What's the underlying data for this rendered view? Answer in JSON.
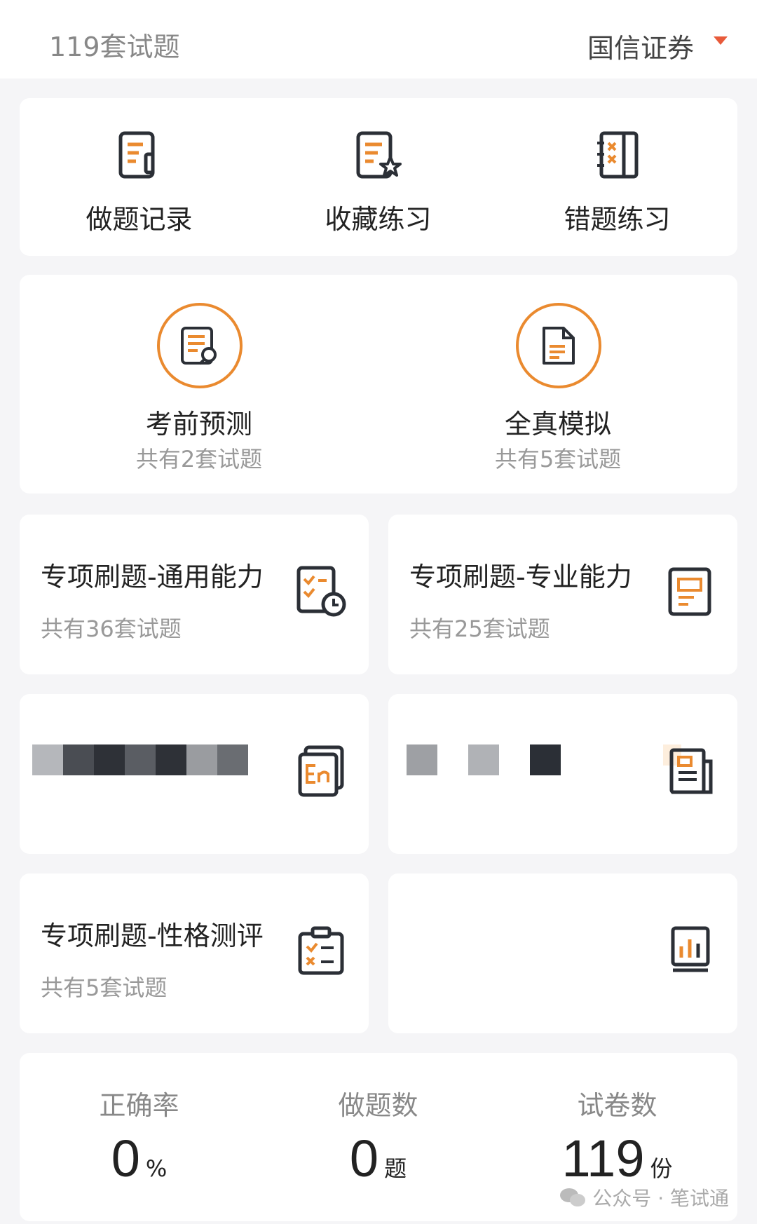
{
  "header": {
    "count_label": "119套试题",
    "org_label": "国信证券"
  },
  "quick_actions": [
    {
      "label": "做题记录",
      "icon": "record-icon"
    },
    {
      "label": "收藏练习",
      "icon": "favorite-icon"
    },
    {
      "label": "错题练习",
      "icon": "wrong-icon"
    }
  ],
  "featured": [
    {
      "title": "考前预测",
      "subtitle": "共有2套试题",
      "icon": "search-doc-icon"
    },
    {
      "title": "全真模拟",
      "subtitle": "共有5套试题",
      "icon": "document-icon"
    }
  ],
  "categories": [
    {
      "title": "专项刷题-通用能力",
      "subtitle": "共有36套试题",
      "icon": "checklist-clock-icon"
    },
    {
      "title": "专项刷题-专业能力",
      "subtitle": "共有25套试题",
      "icon": "notebook-icon"
    },
    {
      "title": "",
      "subtitle": "",
      "icon": "english-icon"
    },
    {
      "title": "",
      "subtitle": "",
      "icon": "newspaper-icon"
    },
    {
      "title": "专项刷题-性格测评",
      "subtitle": "共有5套试题",
      "icon": "clipboard-icon"
    },
    {
      "title": "",
      "subtitle": "",
      "icon": "bar-chart-icon"
    }
  ],
  "stats": [
    {
      "label": "正确率",
      "value": "0",
      "unit": "%"
    },
    {
      "label": "做题数",
      "value": "0",
      "unit": "题"
    },
    {
      "label": "试卷数",
      "value": "119",
      "unit": "份"
    }
  ],
  "watermark": "公众号 · 笔试通",
  "colors": {
    "accent": "#ea8a2f",
    "caret": "#e85a3a",
    "ink": "#2b2f36"
  }
}
